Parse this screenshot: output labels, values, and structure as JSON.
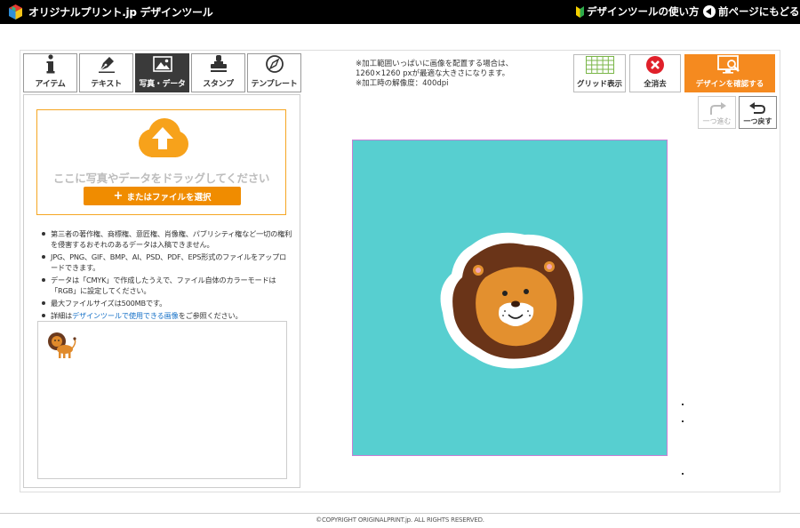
{
  "header": {
    "logo_text": "オリジナルプリント.jp デザインツール",
    "howto_link": "デザインツールの使い方",
    "back_link": "前ページにもどる"
  },
  "tabs": [
    {
      "label": "アイテム",
      "icon": "info-icon",
      "active": false
    },
    {
      "label": "テキスト",
      "icon": "pen-icon",
      "active": false
    },
    {
      "label": "写真・データ",
      "icon": "image-icon",
      "active": true
    },
    {
      "label": "スタンプ",
      "icon": "stamp-icon",
      "active": false
    },
    {
      "label": "テンプレート",
      "icon": "compass-icon",
      "active": false
    }
  ],
  "upload": {
    "drop_text": "ここに写真やデータをドラッグしてください",
    "select_label": "またはファイルを選択",
    "notes": [
      "第三者の著作権、商標権、意匠権、肖像権、パブリシティ権など一切の権利を侵害するおそれのあるデータは入稿できません。",
      "JPG、PNG、GIF、BMP、AI、PSD、PDF、EPS形式のファイルをアップロードできます。",
      "データは「CMYK」で作成したうえで、ファイル自体のカラーモードは「RGB」に設定してください。",
      "最大ファイルサイズは500MBです。"
    ],
    "detail_prefix": "詳細は",
    "detail_link": "デザインツールで使用できる画像",
    "detail_suffix": "をご参照ください。"
  },
  "notice": {
    "line1": "※加工範囲いっぱいに画像を配置する場合は、",
    "line2": "1260×1260 pxが最適な大きさになります。",
    "line3": "※加工時の解像度：400dpi"
  },
  "toolbar": {
    "grid_label": "グリッド表示",
    "clear_label": "全消去",
    "confirm_label": "デザインを確認する",
    "redo_label": "一つ進む",
    "undo_label": "一つ戻す"
  },
  "colors": {
    "accent": "#f58a1f",
    "canvas_bg": "#57cfd0",
    "canvas_border": "#c77fd4",
    "clear_red": "#e0202a",
    "grid_green": "#7ab648"
  },
  "footer": {
    "copyright": "©COPYRIGHT ORIGINALPRINT.jp. ALL RIGHTS RESERVED."
  }
}
